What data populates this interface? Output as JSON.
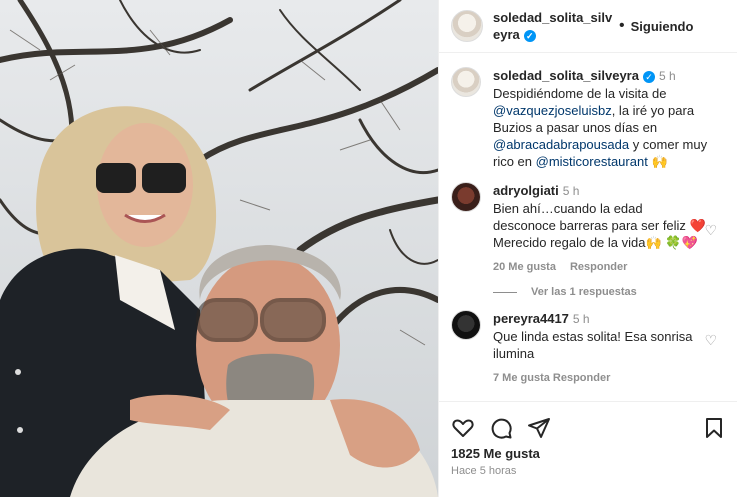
{
  "header": {
    "username": "soledad_solita_silveyra",
    "follow_label": "Siguiendo"
  },
  "caption": {
    "username": "soledad_solita_silveyra",
    "time": "5 h",
    "text_1": "Despidiéndome de la visita de ",
    "mention_1": "@vazquezjoseluisbz",
    "text_2": ", la iré yo para Buzios a pasar unos días en ",
    "mention_2": "@abracadabrapousada",
    "text_3": " y comer muy rico en ",
    "mention_3": "@misticorestaurant",
    "emoji": " 🙌"
  },
  "comments": [
    {
      "username": "adryolgiati",
      "time": "5 h",
      "text": "Bien ahí…cuando la edad desconoce barreras para ser feliz ❤️ Merecido regalo de la vida🙌 🍀💖",
      "likes": "20 Me gusta",
      "reply_label": "Responder",
      "view_replies": "Ver las 1 respuestas"
    },
    {
      "username": "pereyra4417",
      "time": "5 h",
      "text": "Que linda estas solita! Esa sonrisa ilumina",
      "partial": "7 Me gusta   Responder"
    }
  ],
  "footer": {
    "likes": "1825 Me gusta",
    "date": "Hace 5 horas"
  },
  "icons": {
    "verified": "verified-badge",
    "like": "heart-icon",
    "comment": "comment-icon",
    "share": "share-icon",
    "save": "bookmark-icon"
  }
}
